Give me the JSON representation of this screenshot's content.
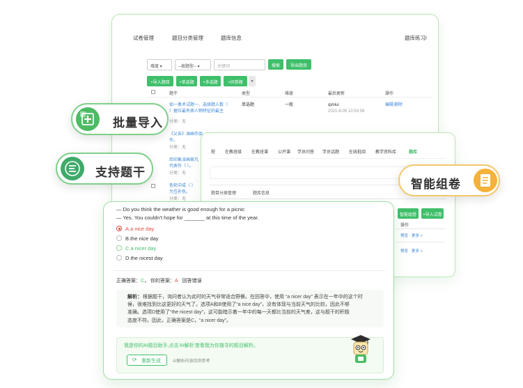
{
  "back_panel": {
    "nav": [
      "试卷管理",
      "题目分类管理",
      "题库信息",
      "题库练习l"
    ],
    "filters": {
      "difficulty": "难度",
      "type": "--按题型--",
      "keyword_placeholder": "关键词",
      "search": "搜索",
      "export": "导出题目"
    },
    "actions": [
      "+导入题目",
      "+单选题",
      "+多选题",
      "+问答题"
    ],
    "columns": [
      "题干",
      "类型",
      "难度",
      "最后更新",
      "操作"
    ],
    "rows": [
      {
        "stem1": "如一奥术试题一、选择题入数（",
        "stem2": "）据位最有病人物特征的最主",
        "meta": "分类：无",
        "type": "单选题",
        "difficulty": "一般",
        "updater": "qimiui",
        "time": "2021-8-05 10:53:09",
        "edit": "编辑",
        "delete": "删除"
      },
      {
        "stem1": "《父亲》油画作品",
        "stem2": "作。",
        "meta": "分类：无"
      },
      {
        "stem1": "后印象派画家凡",
        "stem2": "代表作（ ）。",
        "meta": "分类：无"
      },
      {
        "stem1": "色轮中成（ ）",
        "stem2": "为互补色。",
        "meta": "分类：无"
      }
    ]
  },
  "mid_panel": {
    "nav": [
      "程",
      "在教班级",
      "在教班课",
      "公开课",
      "学员问答",
      "学员话题",
      "在线批阅",
      "教学资料库",
      "题库"
    ],
    "sub_nav": [
      "题目分类管理",
      "题库信息"
    ],
    "buttons": [
      "智能组卷",
      "+导入试卷"
    ],
    "col_header": "操作",
    "row_actions": [
      {
        "a": "预览",
        "b": "更多 >"
      },
      {
        "a": "预览",
        "b": "更多 >"
      }
    ]
  },
  "badges": {
    "bulk_import": "批量导入",
    "support_stem": "支持题干",
    "smart_paper": "智能组卷"
  },
  "question": {
    "line1": "— Do you think the weather is good enough for a picnic",
    "line2": "— Yes. You couldn't hope for _______ at this time of the year.",
    "options": [
      {
        "label": "A.a nice day",
        "state": "selected-wrong"
      },
      {
        "label": "B.the nice day",
        "state": "normal"
      },
      {
        "label": "C.a nicer day",
        "state": "correct"
      },
      {
        "label": "D.the nicest day",
        "state": "normal"
      }
    ],
    "correct_label": "正确答案：",
    "correct_value": "C",
    "your_label": "，  你的答案：",
    "your_value": "A",
    "result": "回答错误",
    "analysis_title": "解析：",
    "analysis_lines": [
      "根据题干，询问者认为此时的天气非常适合野餐。在回答中，使用 “a nicer day” 表示在一年中的这个时",
      "候，很难找到比这更好的天气了。选项A和B使用了“a nice day”，没有体现与当前天气的比较，因此不够",
      "准确。选项D使用了“the nicest day”，这可能暗示着一年中的每一天都比当前的天气差，这与题干的积极",
      "态度不符。因此，正确答案是C，“a nicer day”。"
    ],
    "ai_prompt": "我是你的AI题目助手,点击'AI解析'查看我为你搜寻的题目解析。",
    "regenerate": "重新生成",
    "disclaimer": "AI解析内容仅供参考"
  },
  "colors": {
    "green": "#3fbf6a",
    "light_green": "#7fd08a",
    "orange": "#f4b23a",
    "red": "#e04a3a",
    "link_blue": "#3c86d6"
  }
}
